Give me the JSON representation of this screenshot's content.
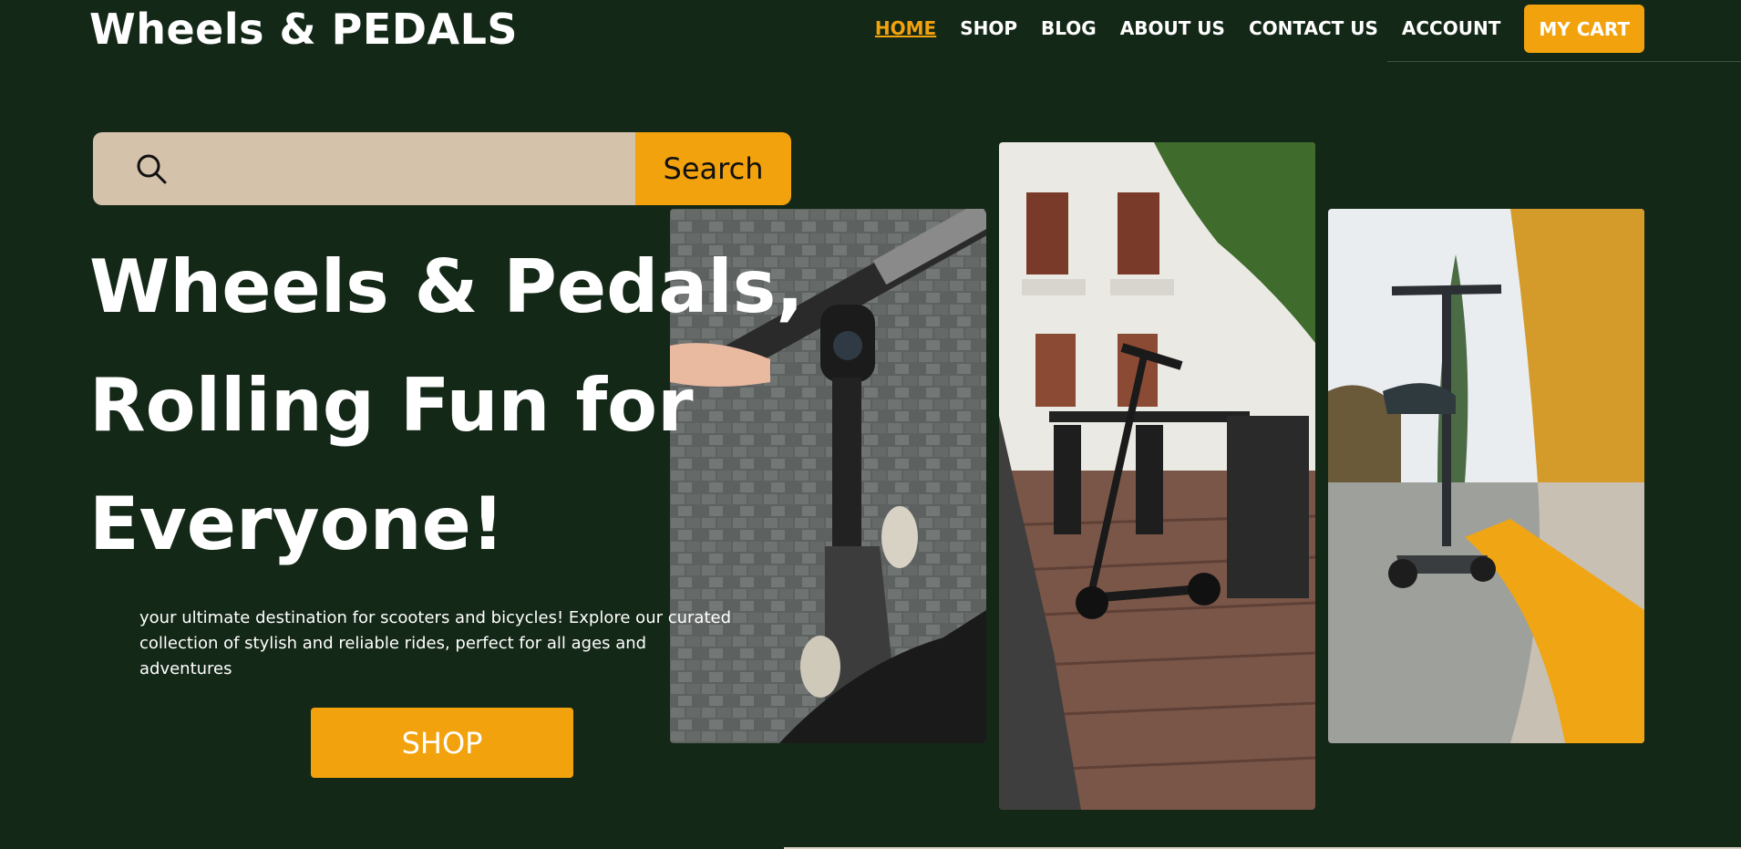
{
  "brand": {
    "logo": "Wheels & PEDALS"
  },
  "nav": {
    "items": [
      {
        "label": "HOME",
        "active": true
      },
      {
        "label": "SHOP"
      },
      {
        "label": "BLOG"
      },
      {
        "label": "ABOUT US"
      },
      {
        "label": "CONTACT US"
      },
      {
        "label": "ACCOUNT"
      }
    ],
    "cart_label": "MY CART"
  },
  "search": {
    "value": "",
    "placeholder": "",
    "button_label": "Search",
    "icon": "search-icon"
  },
  "hero": {
    "headline": [
      "Wheels & Pedals,",
      "Rolling Fun for",
      "Everyone!"
    ],
    "tagline": " your ultimate destination for scooters and bicycles! Explore our curated collection of stylish and reliable rides, perfect for all ages and adventures",
    "cta_label": "SHOP"
  },
  "gallery": [
    {
      "subject": "scooter-handlebar-photo"
    },
    {
      "subject": "scooter-cafe-terrace-photo"
    },
    {
      "subject": "scooter-autumn-street-photo"
    }
  ],
  "colors": {
    "background": "#142817",
    "accent": "#f2a20c",
    "search_field": "#d5c2ab",
    "text": "#ffffff"
  }
}
